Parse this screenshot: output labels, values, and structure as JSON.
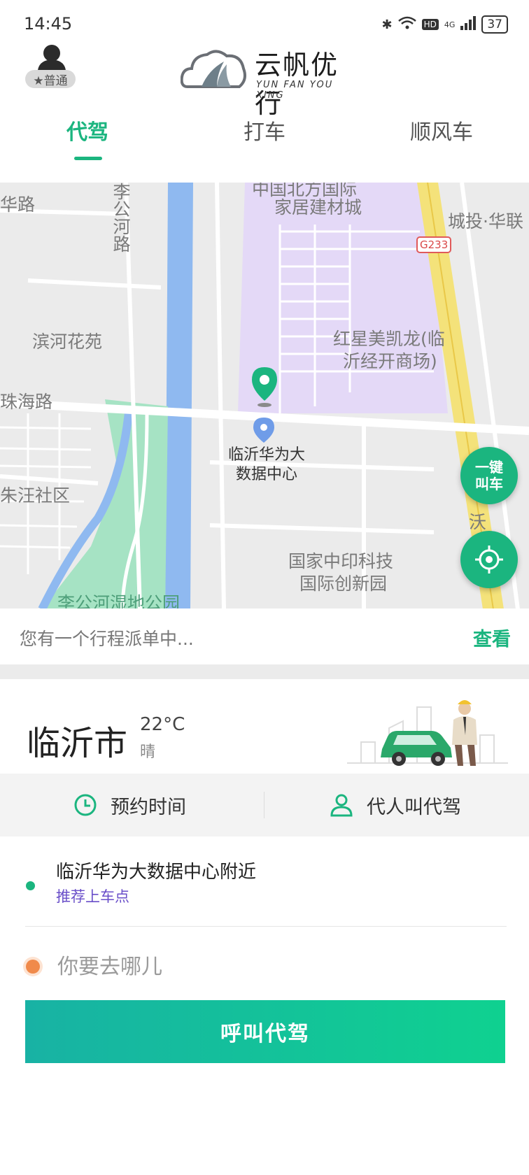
{
  "status_bar": {
    "time": "14:45",
    "network": "HD",
    "signal_type": "4G",
    "battery": "37"
  },
  "header": {
    "level_badge": "★普通",
    "logo_title": "云帆优行",
    "logo_subtitle": "YUN FAN YOU XING"
  },
  "tabs": [
    {
      "label": "代驾",
      "active": true
    },
    {
      "label": "打车",
      "active": false
    },
    {
      "label": "顺风车",
      "active": false
    }
  ],
  "map": {
    "labels": [
      "华路",
      "李公河路",
      "中国北方国际",
      "家居建材城",
      "城投·华联",
      "G233",
      "滨河花苑",
      "红星美凯龙(临",
      "沂经开商场)",
      "珠海路",
      "朱汪社区",
      "沃",
      "国家中印科技",
      "国际创新园",
      "李公河湿地公园"
    ],
    "poi_label_line1": "临沂华为大",
    "poi_label_line2": "数据中心",
    "quick_call_line1": "一键",
    "quick_call_line2": "叫车"
  },
  "trip_notice": {
    "text": "您有一个行程派单中...",
    "link": "查看"
  },
  "city_info": {
    "city": "临沂市",
    "temperature": "22°C",
    "weather": "晴"
  },
  "options": {
    "reserve_time": "预约时间",
    "call_for_others": "代人叫代驾"
  },
  "address": {
    "pickup": "临沂华为大数据中心附近",
    "recommend": "推荐上车点",
    "destination_placeholder": "你要去哪儿"
  },
  "call_button": "呼叫代驾",
  "colors": {
    "accent": "#1bb57f",
    "recommend_text": "#6a4fc9",
    "destination_dot": "#f08a4b",
    "map_purple": "#e4d9f7",
    "map_green": "#a6e3c4",
    "map_water": "#8fb9f0",
    "road_yellow": "#f4e27a"
  }
}
